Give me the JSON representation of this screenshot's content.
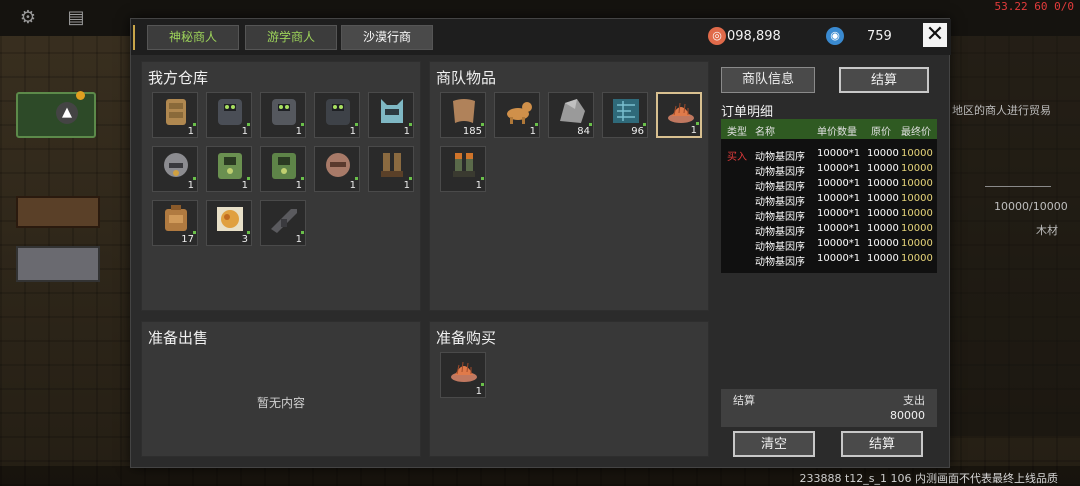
{
  "background": {
    "top_right_label": "53.22 60 0/0",
    "right_text_1": "地区的商人进行贸易",
    "right_text_2": "10000/10000",
    "right_text_3": "木材",
    "watermark": "233888 t12_s_1 106  内测画面不代表最终上线品质"
  },
  "tabs": [
    {
      "label": "神秘商人"
    },
    {
      "label": "游学商人"
    },
    {
      "label": "沙漠行商"
    }
  ],
  "currency": {
    "coins": "098,898",
    "gems": "759"
  },
  "close_label": "✕",
  "my_warehouse": {
    "title": "我方仓库",
    "items": [
      {
        "name": "vest-armor",
        "qty": "1"
      },
      {
        "name": "power-armor-1",
        "qty": "1"
      },
      {
        "name": "power-armor-2",
        "qty": "1"
      },
      {
        "name": "power-armor-3",
        "qty": "1"
      },
      {
        "name": "cat-helmet",
        "qty": "1"
      },
      {
        "name": "gray-helmet",
        "qty": "1"
      },
      {
        "name": "green-armor-1",
        "qty": "1"
      },
      {
        "name": "green-armor-2",
        "qty": "1"
      },
      {
        "name": "brown-helmet",
        "qty": "1"
      },
      {
        "name": "boots",
        "qty": "1"
      },
      {
        "name": "backpack",
        "qty": "17"
      },
      {
        "name": "meal-plate",
        "qty": "3"
      },
      {
        "name": "rifle",
        "qty": "1"
      }
    ]
  },
  "caravan_items": {
    "title": "商队物品",
    "items": [
      {
        "name": "leather",
        "qty": "185"
      },
      {
        "name": "dog",
        "qty": "1"
      },
      {
        "name": "stone",
        "qty": "84"
      },
      {
        "name": "circuit",
        "qty": "96"
      },
      {
        "name": "dimetrodon",
        "qty": "1",
        "selected": true
      },
      {
        "name": "green-boots",
        "qty": "1"
      }
    ]
  },
  "ready_sell": {
    "title": "准备出售",
    "empty": "暂无内容"
  },
  "ready_buy": {
    "title": "准备购买",
    "items": [
      {
        "name": "dimetrodon",
        "qty": "1"
      }
    ]
  },
  "side": {
    "caravan_info_button": "商队信息",
    "settle_top_button": "结算",
    "order_title": "订单明细",
    "columns": {
      "type": "类型",
      "name": "名称",
      "unit": "单价数量",
      "price": "原价",
      "final": "最终价"
    },
    "rows": [
      {
        "type": "买入",
        "name": "动物基因序",
        "unit": "10000*1",
        "price": "10000",
        "final": "10000"
      },
      {
        "type": "",
        "name": "动物基因序",
        "unit": "10000*1",
        "price": "10000",
        "final": "10000"
      },
      {
        "type": "",
        "name": "动物基因序",
        "unit": "10000*1",
        "price": "10000",
        "final": "10000"
      },
      {
        "type": "",
        "name": "动物基因序",
        "unit": "10000*1",
        "price": "10000",
        "final": "10000"
      },
      {
        "type": "",
        "name": "动物基因序",
        "unit": "10000*1",
        "price": "10000",
        "final": "10000"
      },
      {
        "type": "",
        "name": "动物基因序",
        "unit": "10000*1",
        "price": "10000",
        "final": "10000"
      },
      {
        "type": "",
        "name": "动物基因序",
        "unit": "10000*1",
        "price": "10000",
        "final": "10000"
      },
      {
        "type": "",
        "name": "动物基因序",
        "unit": "10000*1",
        "price": "10000",
        "final": "10000"
      }
    ],
    "summary_label": "结算",
    "expense_label": "支出",
    "expense_value": "80000",
    "clear_button": "清空",
    "settle_button": "结算"
  }
}
